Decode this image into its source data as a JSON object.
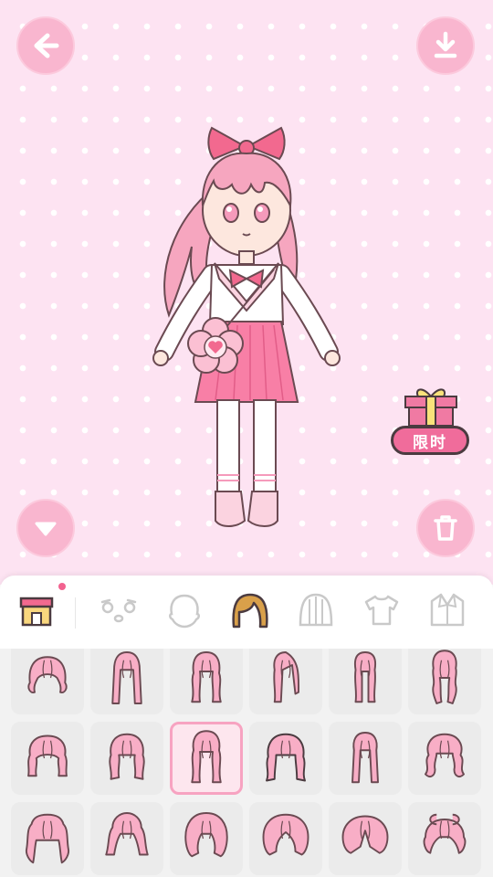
{
  "stage": {
    "background_color": "#fde3f2",
    "buttons": [
      {
        "name": "back-arrow-icon"
      },
      {
        "name": "download-icon"
      },
      {
        "name": "chevron-down-icon"
      },
      {
        "name": "trash-icon"
      }
    ]
  },
  "promo": {
    "label": "限时",
    "icon": "gift-box-icon"
  },
  "tabs": {
    "items": [
      {
        "name": "tab-shop",
        "icon": "shop-icon",
        "badge": true
      },
      {
        "name": "tab-eyes",
        "icon": "eyes-face-icon"
      },
      {
        "name": "tab-head",
        "icon": "head-icon"
      },
      {
        "name": "tab-hair",
        "icon": "hair-icon",
        "selected": true
      },
      {
        "name": "tab-back-hair",
        "icon": "back-hair-icon"
      },
      {
        "name": "tab-top",
        "icon": "tshirt-icon"
      },
      {
        "name": "tab-outerwear",
        "icon": "jacket-icon"
      }
    ]
  },
  "hair_grid": {
    "selected_index": 8,
    "items": [
      {
        "style": "short-wavy-bob"
      },
      {
        "style": "long-straight"
      },
      {
        "style": "long-wavy"
      },
      {
        "style": "long-side"
      },
      {
        "style": "long-bangs"
      },
      {
        "style": "braids"
      },
      {
        "style": "short-curly"
      },
      {
        "style": "medium-wavy"
      },
      {
        "style": "long-curly-selected"
      },
      {
        "style": "dark-curly"
      },
      {
        "style": "long-straight-2"
      },
      {
        "style": "voluminous-curly"
      },
      {
        "style": "bun-updo"
      },
      {
        "style": "ponytail-top"
      },
      {
        "style": "short-bob"
      },
      {
        "style": "side-sweep-bob"
      },
      {
        "style": "side-parted-bob"
      },
      {
        "style": "double-buns"
      }
    ]
  }
}
